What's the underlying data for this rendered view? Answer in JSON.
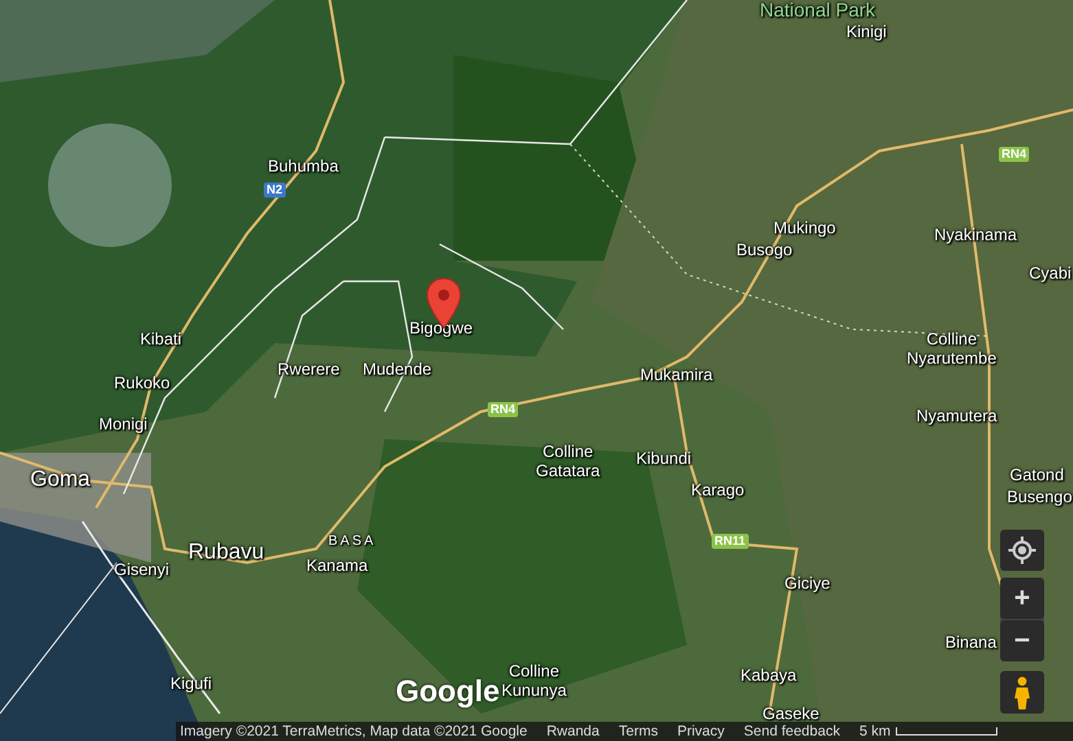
{
  "map": {
    "labels": [
      {
        "text": "National Park",
        "kind": "park"
      },
      {
        "text": "Kinigi",
        "kind": "town"
      },
      {
        "text": "Buhumba",
        "kind": "town"
      },
      {
        "text": "N2",
        "kind": "shield",
        "color": "#3b78c9"
      },
      {
        "text": "RN4",
        "kind": "shield",
        "color": "#8bc34a"
      },
      {
        "text": "Mukingo",
        "kind": "town"
      },
      {
        "text": "Busogo",
        "kind": "town"
      },
      {
        "text": "Nyakinama",
        "kind": "town"
      },
      {
        "text": "Cyabi",
        "kind": "town"
      },
      {
        "text": "Bigogwe",
        "kind": "town"
      },
      {
        "text": "Kibati",
        "kind": "town"
      },
      {
        "text": "Rwerere",
        "kind": "town"
      },
      {
        "text": "Mudende",
        "kind": "town"
      },
      {
        "text": "Mukamira",
        "kind": "town"
      },
      {
        "text": "Colline\nNyarutembe",
        "kind": "town"
      },
      {
        "text": "Rukoko",
        "kind": "town"
      },
      {
        "text": "RN4",
        "kind": "shield",
        "color": "#8bc34a"
      },
      {
        "text": "Nyamutera",
        "kind": "town"
      },
      {
        "text": "Monigi",
        "kind": "town"
      },
      {
        "text": "Colline\nGatatara",
        "kind": "town"
      },
      {
        "text": "Kibundi",
        "kind": "town"
      },
      {
        "text": "Gatond",
        "kind": "town"
      },
      {
        "text": "Busengo",
        "kind": "town"
      },
      {
        "text": "Goma",
        "kind": "city"
      },
      {
        "text": "Karago",
        "kind": "town"
      },
      {
        "text": "RN11",
        "kind": "shield",
        "color": "#8bc34a"
      },
      {
        "text": "BASA",
        "kind": "district"
      },
      {
        "text": "Rubavu",
        "kind": "city"
      },
      {
        "text": "Kanama",
        "kind": "town"
      },
      {
        "text": "Gisenyi",
        "kind": "town"
      },
      {
        "text": "Giciye",
        "kind": "town"
      },
      {
        "text": "Kigufi",
        "kind": "town"
      },
      {
        "text": "Colline\nKununya",
        "kind": "town"
      },
      {
        "text": "Kabaya",
        "kind": "town"
      },
      {
        "text": "Binana",
        "kind": "town"
      },
      {
        "text": "Gaseke",
        "kind": "town"
      }
    ]
  },
  "logo": "Google",
  "controls": {
    "zoom_in": "+",
    "zoom_out": "−"
  },
  "footer": {
    "attribution": "Imagery ©2021 TerraMetrics, Map data ©2021 Google",
    "links": [
      "Rwanda",
      "Terms",
      "Privacy",
      "Send feedback"
    ],
    "scale": "5 km"
  }
}
